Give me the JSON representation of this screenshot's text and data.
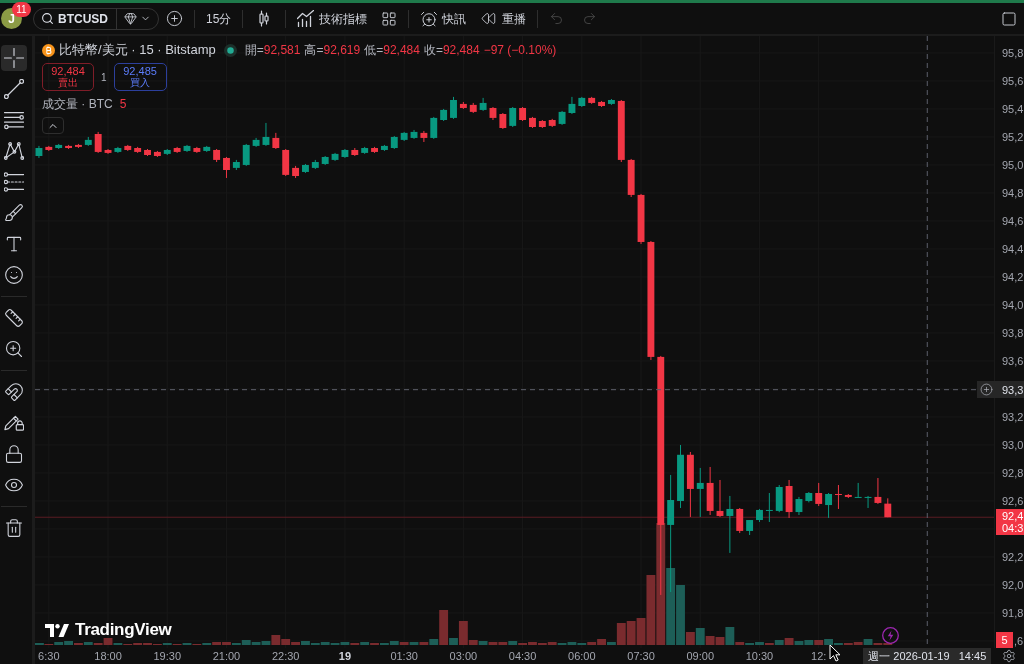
{
  "toolbar": {
    "account": {
      "initial": "J",
      "notifications": "11"
    },
    "symbol": "BTCUSD",
    "interval": "15分",
    "indicators": "技術指標",
    "alerts": "快訊",
    "replay": "重播",
    "undo": {
      "disabled": true
    },
    "redo": {
      "disabled": true
    }
  },
  "drawing_tools": [
    {
      "tools": [
        {
          "kind": "crosshair",
          "selected": true
        },
        {
          "kind": "trendline",
          "selected": false
        },
        {
          "kind": "fibonacci",
          "selected": false
        },
        {
          "kind": "pattern",
          "selected": false
        },
        {
          "kind": "forecast",
          "selected": false
        },
        {
          "kind": "brush",
          "selected": false
        },
        {
          "kind": "text",
          "selected": false
        },
        {
          "kind": "emoji",
          "selected": false
        }
      ]
    },
    {
      "tools": [
        {
          "kind": "ruler",
          "selected": false
        },
        {
          "kind": "zoom",
          "selected": false
        }
      ]
    },
    {
      "tools": [
        {
          "kind": "magnet",
          "selected": false
        },
        {
          "kind": "drawlock",
          "selected": false
        },
        {
          "kind": "lock",
          "selected": false
        },
        {
          "kind": "visibility",
          "selected": false
        }
      ]
    },
    {
      "tools": [
        {
          "kind": "trash",
          "selected": false
        }
      ]
    }
  ],
  "legend": {
    "title": "比特幣/美元 · 15 · Bitstamp",
    "market_open": true,
    "ohlc": [
      {
        "label": "開=",
        "value": "92,581"
      },
      {
        "label": "高=",
        "value": "92,619"
      },
      {
        "label": "低=",
        "value": "92,484"
      },
      {
        "label": "收=",
        "value": "92,484"
      }
    ],
    "change": "−97 (−0.10%)",
    "sell": {
      "price": "92,484",
      "label": "賣出"
    },
    "spread": "1",
    "buy": {
      "price": "92,485",
      "label": "買入"
    },
    "volume_title": "成交量 · BTC",
    "volume_value": "5",
    "expanded": true
  },
  "price_axis": {
    "labels": [
      "95,8",
      "95,6",
      "95,4",
      "95,2",
      "95,0",
      "94,8",
      "94,6",
      "94,4",
      "94,2",
      "94,0",
      "93,8",
      "93,6",
      "93,2",
      "93,0",
      "92,8",
      "92,6",
      "92,2",
      "92,0",
      "91,8"
    ],
    "crosshair_price": "93,3",
    "last_price": "92,4",
    "countdown": "04:3",
    "volume": "5",
    "covered_label": ",6"
  },
  "time_axis": {
    "labels": [
      "6:30",
      "18:00",
      "19:30",
      "21:00",
      "22:30",
      "01:30",
      "03:00",
      "04:30",
      "06:00",
      "07:30",
      "09:00",
      "10:30",
      "12:"
    ],
    "date_label": "19",
    "crosshair_date": "週一 2026-01-19",
    "crosshair_time": "14:45"
  },
  "branding": "TradingView"
}
